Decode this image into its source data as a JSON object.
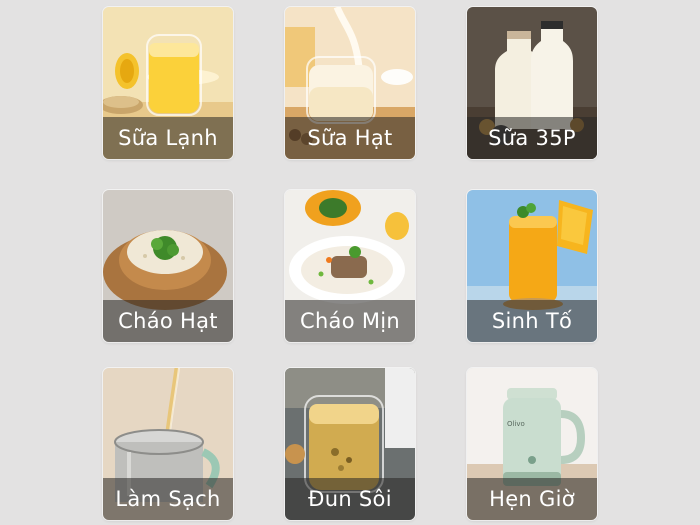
{
  "menu": {
    "items": [
      {
        "label": "Sữa Lạnh",
        "icon": "chilled-milk-glass-icon"
      },
      {
        "label": "Sữa Hạt",
        "icon": "nut-milk-pour-icon"
      },
      {
        "label": "Sữa 35P",
        "icon": "milk-bottles-icon"
      },
      {
        "label": "Cháo Hạt",
        "icon": "grain-porridge-bowl-icon"
      },
      {
        "label": "Cháo Mịn",
        "icon": "smooth-porridge-bowl-icon"
      },
      {
        "label": "Sinh Tố",
        "icon": "mango-smoothie-icon"
      },
      {
        "label": "Làm Sạch",
        "icon": "clean-jug-icon"
      },
      {
        "label": "Đun Sôi",
        "icon": "boil-tea-glass-icon"
      },
      {
        "label": "Hẹn Giờ",
        "icon": "timer-kettle-icon"
      }
    ]
  },
  "kettle_brand": "Olivo",
  "colors": {
    "background": "#e3e2e2",
    "caption_overlay": "rgba(40,38,36,0.55)",
    "caption_text": "#ffffff"
  }
}
